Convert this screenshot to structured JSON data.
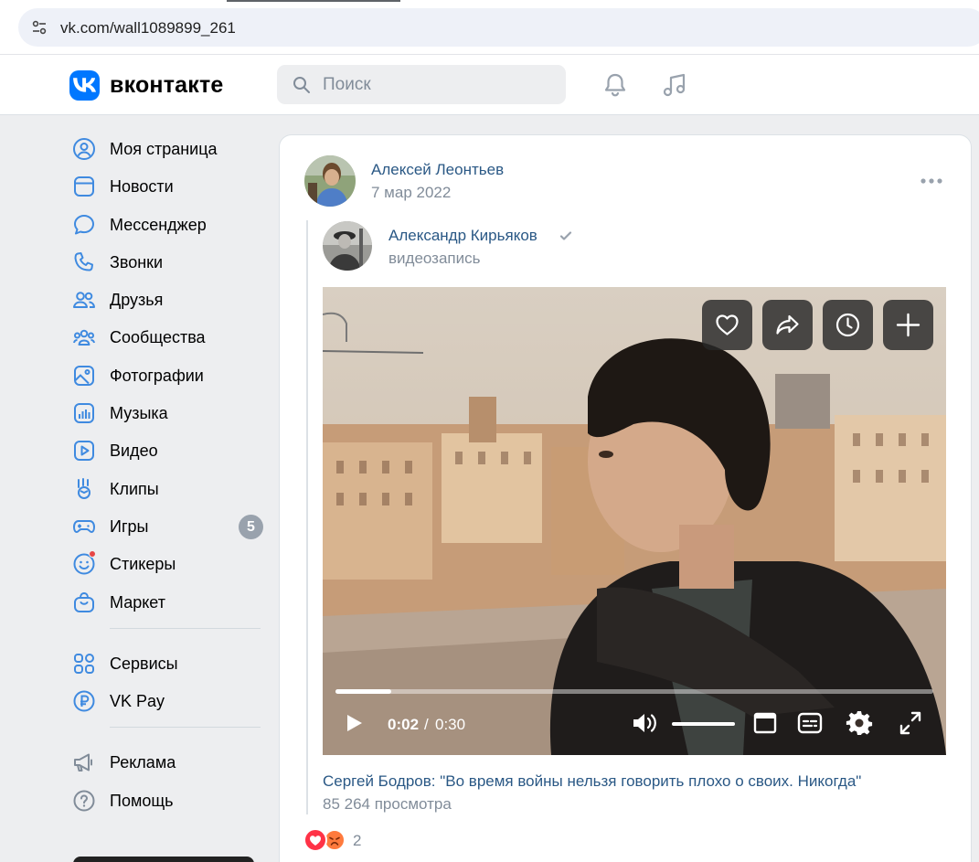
{
  "browser": {
    "url": "vk.com/wall1089899_261"
  },
  "header": {
    "logo_text": "вконтакте",
    "search_placeholder": "Поиск",
    "icons": [
      "bell-icon",
      "music-note-icon"
    ]
  },
  "sidebar": {
    "items": [
      {
        "label": "Моя страница",
        "icon": "user-circle-icon"
      },
      {
        "label": "Новости",
        "icon": "news-icon"
      },
      {
        "label": "Мессенджер",
        "icon": "chat-bubble-icon"
      },
      {
        "label": "Звонки",
        "icon": "phone-icon"
      },
      {
        "label": "Друзья",
        "icon": "friends-icon"
      },
      {
        "label": "Сообщества",
        "icon": "communities-icon"
      },
      {
        "label": "Фотографии",
        "icon": "photo-icon"
      },
      {
        "label": "Музыка",
        "icon": "music-bars-icon"
      },
      {
        "label": "Видео",
        "icon": "video-icon"
      },
      {
        "label": "Клипы",
        "icon": "clips-icon"
      },
      {
        "label": "Игры",
        "icon": "gamepad-icon",
        "badge": "5"
      },
      {
        "label": "Стикеры",
        "icon": "sticker-icon"
      },
      {
        "label": "Маркет",
        "icon": "bag-icon"
      }
    ],
    "services": [
      {
        "label": "Сервисы",
        "icon": "grid-icon"
      },
      {
        "label": "VK Pay",
        "icon": "ruble-icon"
      }
    ],
    "footer": [
      {
        "label": "Реклама",
        "icon": "megaphone-icon"
      },
      {
        "label": "Помощь",
        "icon": "help-icon"
      }
    ]
  },
  "post": {
    "author": "Алексей Леонтьев",
    "date": "7 мар 2022",
    "repost": {
      "author": "Александр Кирьяков",
      "type": "видеозапись"
    },
    "video": {
      "current_time": "0:02",
      "separator": "/",
      "duration": "0:30",
      "progress": 0.094,
      "volume": 1.0,
      "title": "Сергей Бодров: \"Во время войны нельзя говорить плохо о своих. Никогда\"",
      "views": "85 264 просмотра"
    },
    "reactions": {
      "count": "2",
      "types": [
        "heart-reaction-icon",
        "angry-reaction-icon"
      ]
    }
  },
  "colors": {
    "accent": "#0077ff",
    "link": "#2a5885",
    "secondary_text": "#818c99",
    "page_bg": "#edeef0",
    "badge": "#99a2ad"
  }
}
